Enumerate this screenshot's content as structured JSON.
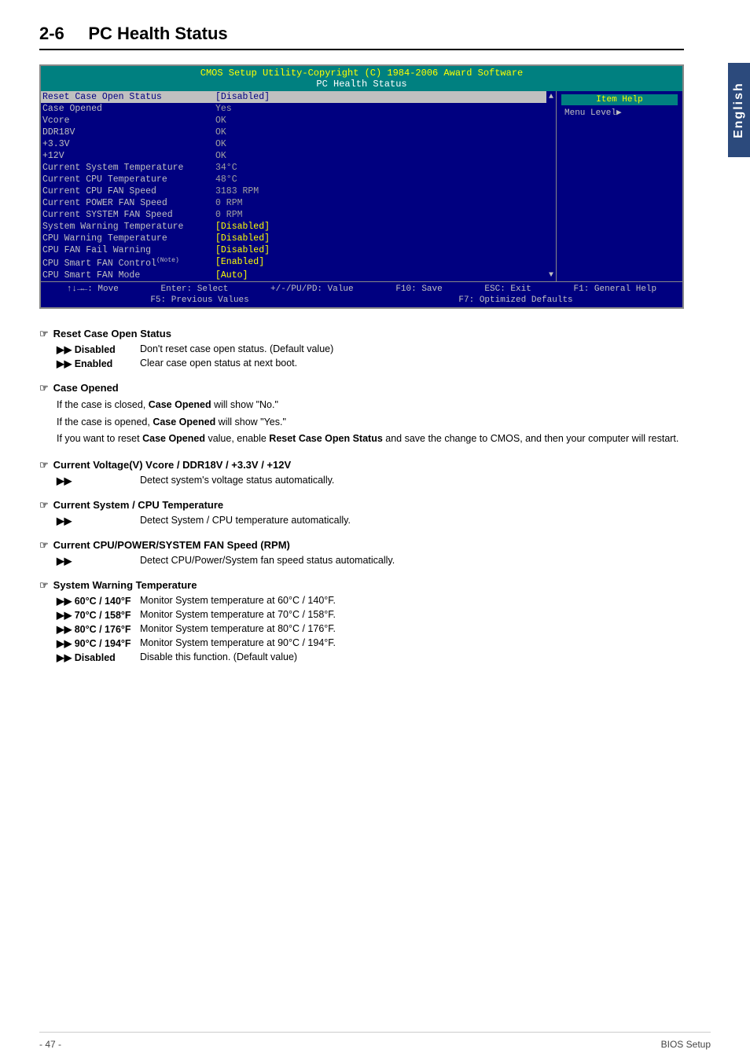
{
  "sideTab": {
    "text": "English"
  },
  "sectionTitle": {
    "num": "2-6",
    "name": "PC Health Status"
  },
  "bios": {
    "header1": "CMOS Setup Utility-Copyright (C) 1984-2006 Award Software",
    "header2": "PC Health Status",
    "rows": [
      {
        "label": "Reset Case Open Status",
        "value": "[Disabled]",
        "selected": true,
        "valueClass": ""
      },
      {
        "label": "Case Opened",
        "value": "Yes",
        "selected": false,
        "valueClass": "gray"
      },
      {
        "label": "Vcore",
        "value": "OK",
        "selected": false,
        "valueClass": "gray"
      },
      {
        "label": "DDR18V",
        "value": "OK",
        "selected": false,
        "valueClass": "gray"
      },
      {
        "label": "+3.3V",
        "value": "OK",
        "selected": false,
        "valueClass": "gray"
      },
      {
        "label": "+12V",
        "value": "OK",
        "selected": false,
        "valueClass": "gray"
      },
      {
        "label": "Current System Temperature",
        "value": "34°C",
        "selected": false,
        "valueClass": "gray"
      },
      {
        "label": "Current CPU Temperature",
        "value": "48°C",
        "selected": false,
        "valueClass": "gray"
      },
      {
        "label": "Current CPU FAN Speed",
        "value": "3183 RPM",
        "selected": false,
        "valueClass": "gray"
      },
      {
        "label": "Current POWER FAN Speed",
        "value": "0    RPM",
        "selected": false,
        "valueClass": "gray"
      },
      {
        "label": "Current SYSTEM FAN Speed",
        "value": "0    RPM",
        "selected": false,
        "valueClass": "gray"
      },
      {
        "label": "System Warning Temperature",
        "value": "[Disabled]",
        "selected": false,
        "valueClass": ""
      },
      {
        "label": "CPU Warning Temperature",
        "value": "[Disabled]",
        "selected": false,
        "valueClass": ""
      },
      {
        "label": "CPU FAN Fail Warning",
        "value": "[Disabled]",
        "selected": false,
        "valueClass": ""
      },
      {
        "label": "CPU Smart FAN Control",
        "value": "[Enabled]",
        "selected": false,
        "valueClass": "",
        "note": "Note"
      },
      {
        "label": "CPU Smart FAN Mode",
        "value": "[Auto]",
        "selected": false,
        "valueClass": ""
      }
    ],
    "rightPanel": {
      "itemHelp": "Item Help",
      "menuLevel": "Menu Level▶"
    },
    "footer": {
      "row1": [
        "↑↓→←: Move",
        "Enter: Select",
        "+/-/PU/PD: Value",
        "F10: Save",
        "ESC: Exit",
        "F1: General Help"
      ],
      "row2": [
        "F5: Previous Values",
        "F7: Optimized Defaults"
      ]
    }
  },
  "descriptions": [
    {
      "id": "reset-case",
      "title": "Reset Case Open Status",
      "items": [
        {
          "bullet": "▶▶ Disabled",
          "text": "Don't reset case open status. (Default value)"
        },
        {
          "bullet": "▶▶ Enabled",
          "text": "Clear case open status at next boot."
        }
      ],
      "paras": []
    },
    {
      "id": "case-opened",
      "title": "Case Opened",
      "items": [],
      "paras": [
        "If the case is closed, <b>Case Opened</b> will show \"No.\"",
        "If the case is opened, <b>Case Opened</b> will show \"Yes.\"",
        "If you want to reset <b>Case Opened</b> value, enable <b>Reset Case Open Status</b> and save the change to CMOS, and then your computer will restart."
      ]
    },
    {
      "id": "voltage",
      "title": "Current Voltage(V) Vcore / DDR18V / +3.3V / +12V",
      "items": [
        {
          "bullet": "▶▶",
          "text": "Detect system's voltage status automatically."
        }
      ],
      "paras": []
    },
    {
      "id": "temp",
      "title": "Current System / CPU Temperature",
      "items": [
        {
          "bullet": "▶▶",
          "text": "Detect System / CPU temperature automatically."
        }
      ],
      "paras": []
    },
    {
      "id": "fan-speed",
      "title": "Current CPU/POWER/SYSTEM FAN Speed (RPM)",
      "items": [
        {
          "bullet": "▶▶",
          "text": "Detect CPU/Power/System fan speed status automatically."
        }
      ],
      "paras": []
    },
    {
      "id": "warning-temp",
      "title": "System Warning Temperature",
      "items": [
        {
          "bullet": "▶▶ 60°C / 140°F",
          "text": "Monitor System temperature at 60°C / 140°F."
        },
        {
          "bullet": "▶▶ 70°C / 158°F",
          "text": "Monitor System temperature at 70°C / 158°F."
        },
        {
          "bullet": "▶▶ 80°C / 176°F",
          "text": "Monitor System temperature at 80°C / 176°F."
        },
        {
          "bullet": "▶▶ 90°C / 194°F",
          "text": "Monitor System temperature at 90°C / 194°F."
        },
        {
          "bullet": "▶▶ Disabled",
          "text": "Disable this function. (Default value)"
        }
      ],
      "paras": []
    }
  ],
  "bottomBar": {
    "pageNum": "- 47 -",
    "label": "BIOS Setup"
  }
}
